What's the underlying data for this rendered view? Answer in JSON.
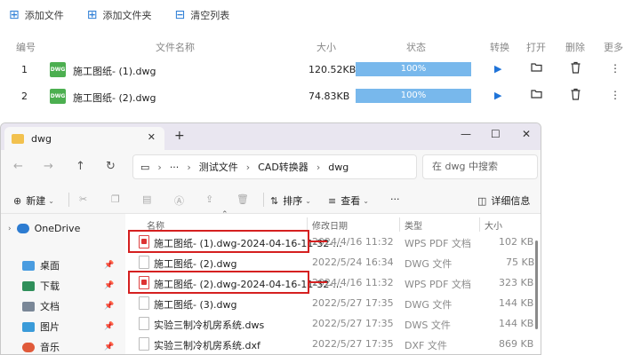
{
  "toolbar": {
    "add_file": "添加文件",
    "add_folder": "添加文件夹",
    "clear_list": "清空列表"
  },
  "header": {
    "num": "编号",
    "name": "文件名称",
    "size": "大小",
    "status": "状态",
    "convert": "转换",
    "open": "打开",
    "delete": "删除",
    "more": "更多"
  },
  "files": [
    {
      "num": "1",
      "type": "DWG",
      "name": "施工图纸- (1).dwg",
      "size": "120.52KB",
      "progress": 100,
      "progress_label": "100%"
    },
    {
      "num": "2",
      "type": "DWG",
      "name": "施工图纸- (2).dwg",
      "size": "74.83KB",
      "progress": 100,
      "progress_label": "100%"
    }
  ],
  "explorer": {
    "tab_title": "dwg",
    "path": [
      "测试文件",
      "CAD转换器",
      "dwg"
    ],
    "path_ellipsis": "···",
    "search_placeholder": "在 dwg 中搜索",
    "new_label": "新建",
    "sort_label": "排序",
    "view_label": "查看",
    "more_label": "···",
    "details_label": "详细信息",
    "sidebar": [
      {
        "label": "OneDrive"
      },
      {
        "label": "桌面"
      },
      {
        "label": "下载"
      },
      {
        "label": "文档"
      },
      {
        "label": "图片"
      },
      {
        "label": "音乐"
      }
    ],
    "columns": {
      "name": "名称",
      "date": "修改日期",
      "type": "类型",
      "size": "大小"
    },
    "rows": [
      {
        "name": "施工图纸- (1).dwg-2024-04-16-11-32-...",
        "date": "2024/4/16 11:32",
        "type": "WPS PDF 文档",
        "size": "102 KB",
        "kind": "pdf"
      },
      {
        "name": "施工图纸- (2).dwg",
        "date": "2022/5/24 16:34",
        "type": "DWG 文件",
        "size": "75 KB",
        "kind": "dwg"
      },
      {
        "name": "施工图纸- (2).dwg-2024-04-16-11-32-...",
        "date": "2024/4/16 11:32",
        "type": "WPS PDF 文档",
        "size": "323 KB",
        "kind": "pdf"
      },
      {
        "name": "施工图纸- (3).dwg",
        "date": "2022/5/27 17:35",
        "type": "DWG 文件",
        "size": "144 KB",
        "kind": "dwg"
      },
      {
        "name": "实验三制冷机房系统.dws",
        "date": "2022/5/27 17:35",
        "type": "DWS 文件",
        "size": "144 KB",
        "kind": "dws"
      },
      {
        "name": "实验三制冷机房系统.dxf",
        "date": "2022/5/27 17:35",
        "type": "DXF 文件",
        "size": "869 KB",
        "kind": "dxf"
      }
    ]
  },
  "colors": {
    "accent": "#2f7fd6",
    "progress": "#78b8ec",
    "highlight": "#d52020",
    "file_badge": "#4caf50"
  }
}
